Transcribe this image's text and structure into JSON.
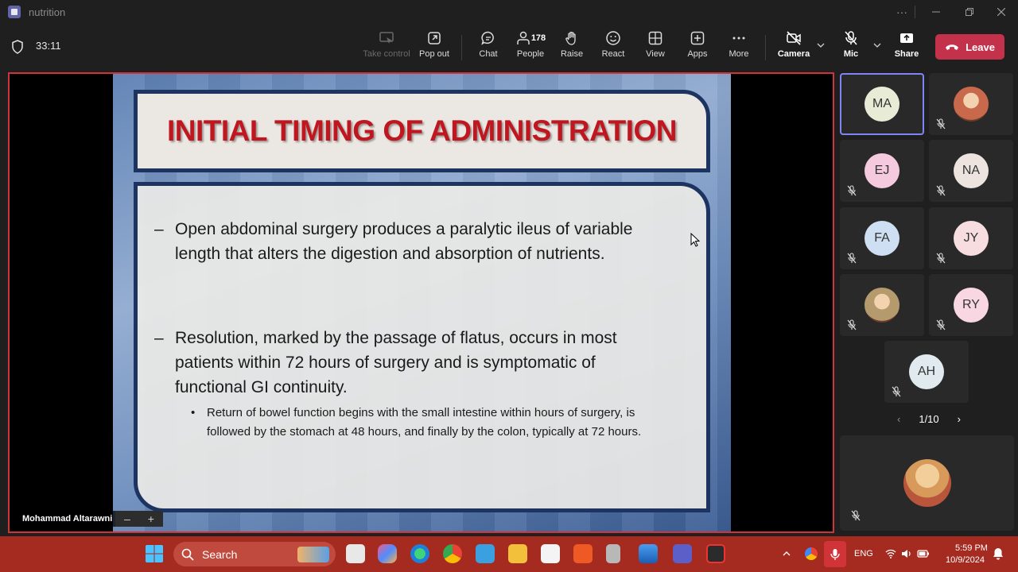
{
  "window": {
    "title": "nutrition",
    "more_label": "···"
  },
  "meeting": {
    "elapsed": "33:11"
  },
  "toolbar": {
    "take_control": "Take control",
    "pop_out": "Pop out",
    "chat": "Chat",
    "people": "People",
    "people_count": "178",
    "raise": "Raise",
    "react": "React",
    "view": "View",
    "apps": "Apps",
    "more": "More",
    "camera": "Camera",
    "mic": "Mic",
    "share": "Share",
    "leave": "Leave"
  },
  "slide": {
    "title": "INITIAL TIMING OF ADMINISTRATION",
    "bullets": [
      "Open abdominal surgery produces a paralytic ileus of variable length that alters the digestion and absorption of nutrients.",
      "Resolution, marked by the passage of flatus, occurs in most patients within 72 hours of surgery and is symptomatic of functional GI continuity."
    ],
    "sub_bullets": [
      "Return of bowel function begins with the small intestine within hours of surgery, is followed by the stomach at 48 hours, and finally by the colon, typically at 72 hours."
    ],
    "dash": "–",
    "dot": "•"
  },
  "presenter": {
    "name": "Mohammad Altarawni"
  },
  "zoom_controls": {
    "minus": "–",
    "plus": "+"
  },
  "participants": [
    {
      "initials": "MA",
      "color": "#e8ebd5",
      "muted": false,
      "photo": false
    },
    {
      "initials": "",
      "color": "#c7694a",
      "muted": true,
      "photo": true
    },
    {
      "initials": "EJ",
      "color": "#f5cadf",
      "muted": true,
      "photo": false
    },
    {
      "initials": "NA",
      "color": "#ede4df",
      "muted": true,
      "photo": false
    },
    {
      "initials": "FA",
      "color": "#cfdff3",
      "muted": true,
      "photo": false
    },
    {
      "initials": "JY",
      "color": "#f7dde0",
      "muted": true,
      "photo": false
    },
    {
      "initials": "",
      "color": "#b49a6c",
      "muted": true,
      "photo": true
    },
    {
      "initials": "RY",
      "color": "#f8d7e3",
      "muted": true,
      "photo": false
    },
    {
      "initials": "AH",
      "color": "#e1ebef",
      "muted": true,
      "photo": false
    }
  ],
  "pager": {
    "label": "1/10",
    "prev": "‹",
    "next": "›"
  },
  "taskbar": {
    "search": "Search",
    "lang": "ENG",
    "time": "5:59 PM",
    "date": "10/9/2024"
  }
}
